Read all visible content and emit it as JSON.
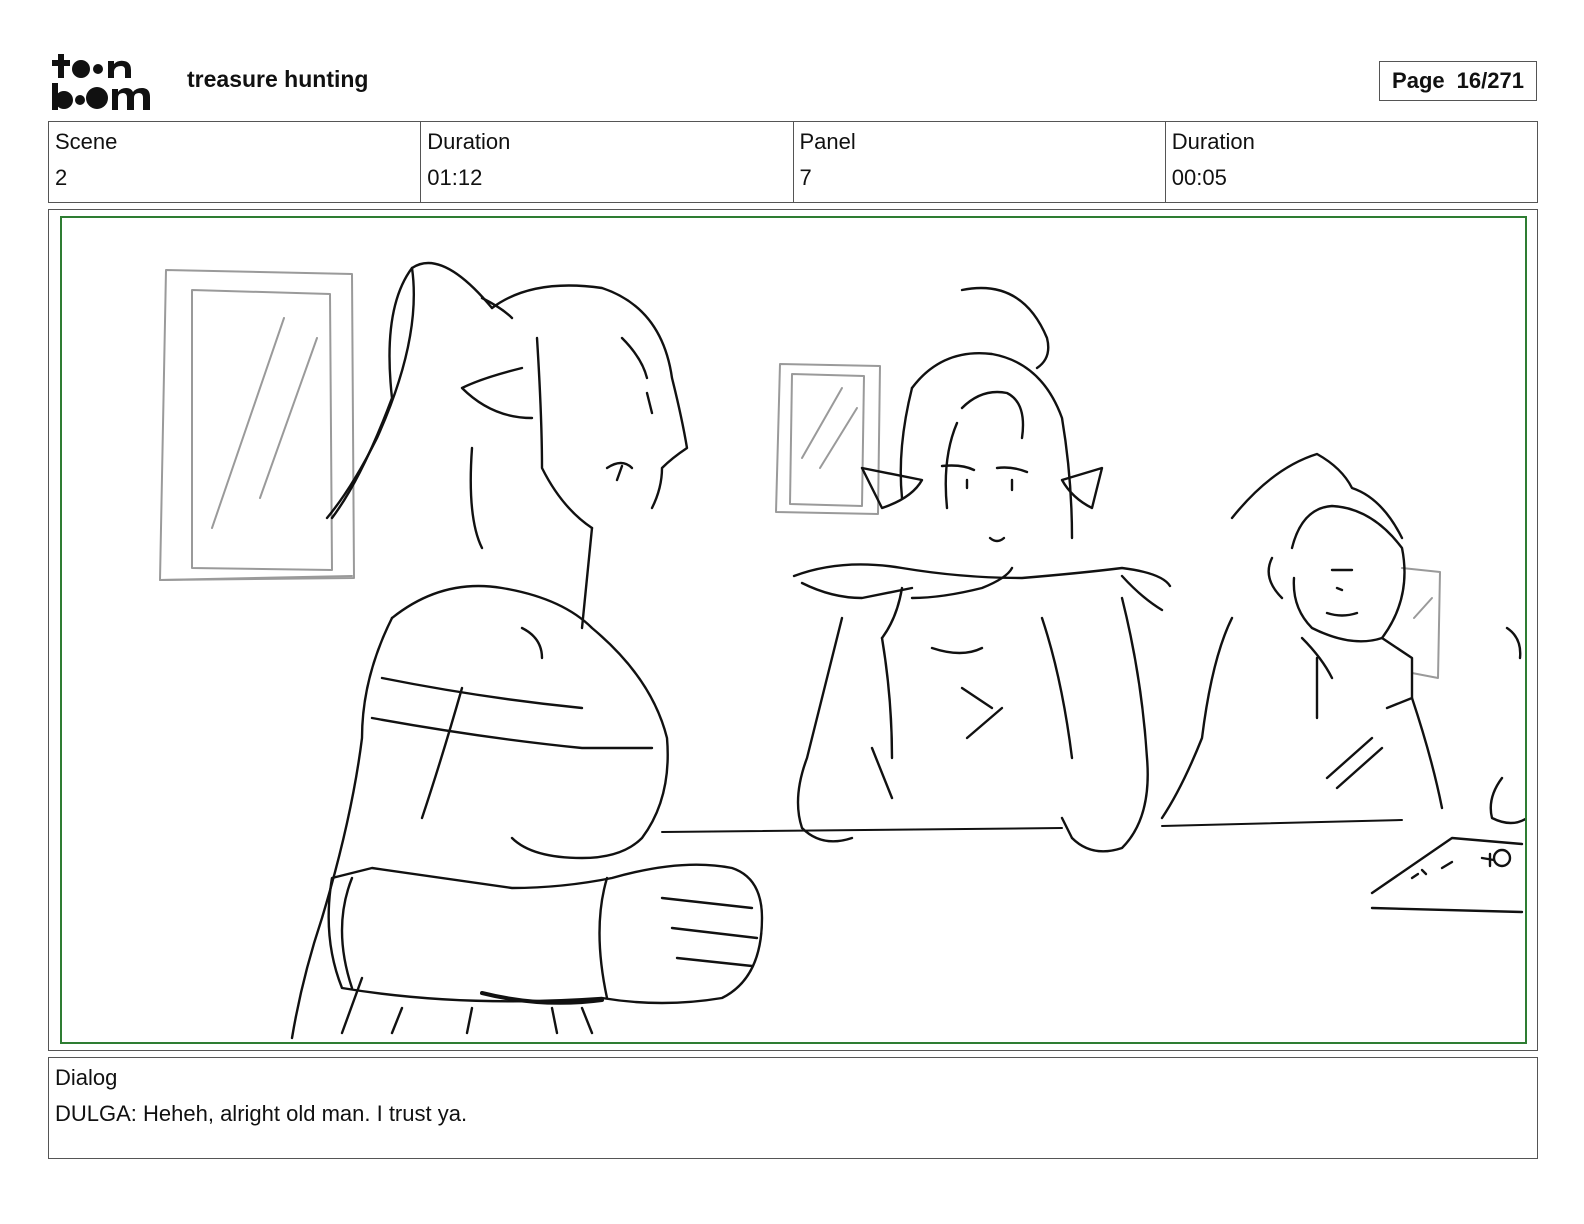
{
  "header": {
    "logo_text": "toon boom",
    "project_title": "treasure hunting",
    "page_label": "Page",
    "page_value": "16/271"
  },
  "info": {
    "scene_label": "Scene",
    "scene_value": "2",
    "scene_duration_label": "Duration",
    "scene_duration_value": "01:12",
    "panel_label": "Panel",
    "panel_value": "7",
    "panel_duration_label": "Duration",
    "panel_duration_value": "00:05"
  },
  "panel": {
    "border_color": "#2e7d32"
  },
  "dialog": {
    "label": "Dialog",
    "text": "DULGA: Heheh, alright old man. I trust ya."
  }
}
